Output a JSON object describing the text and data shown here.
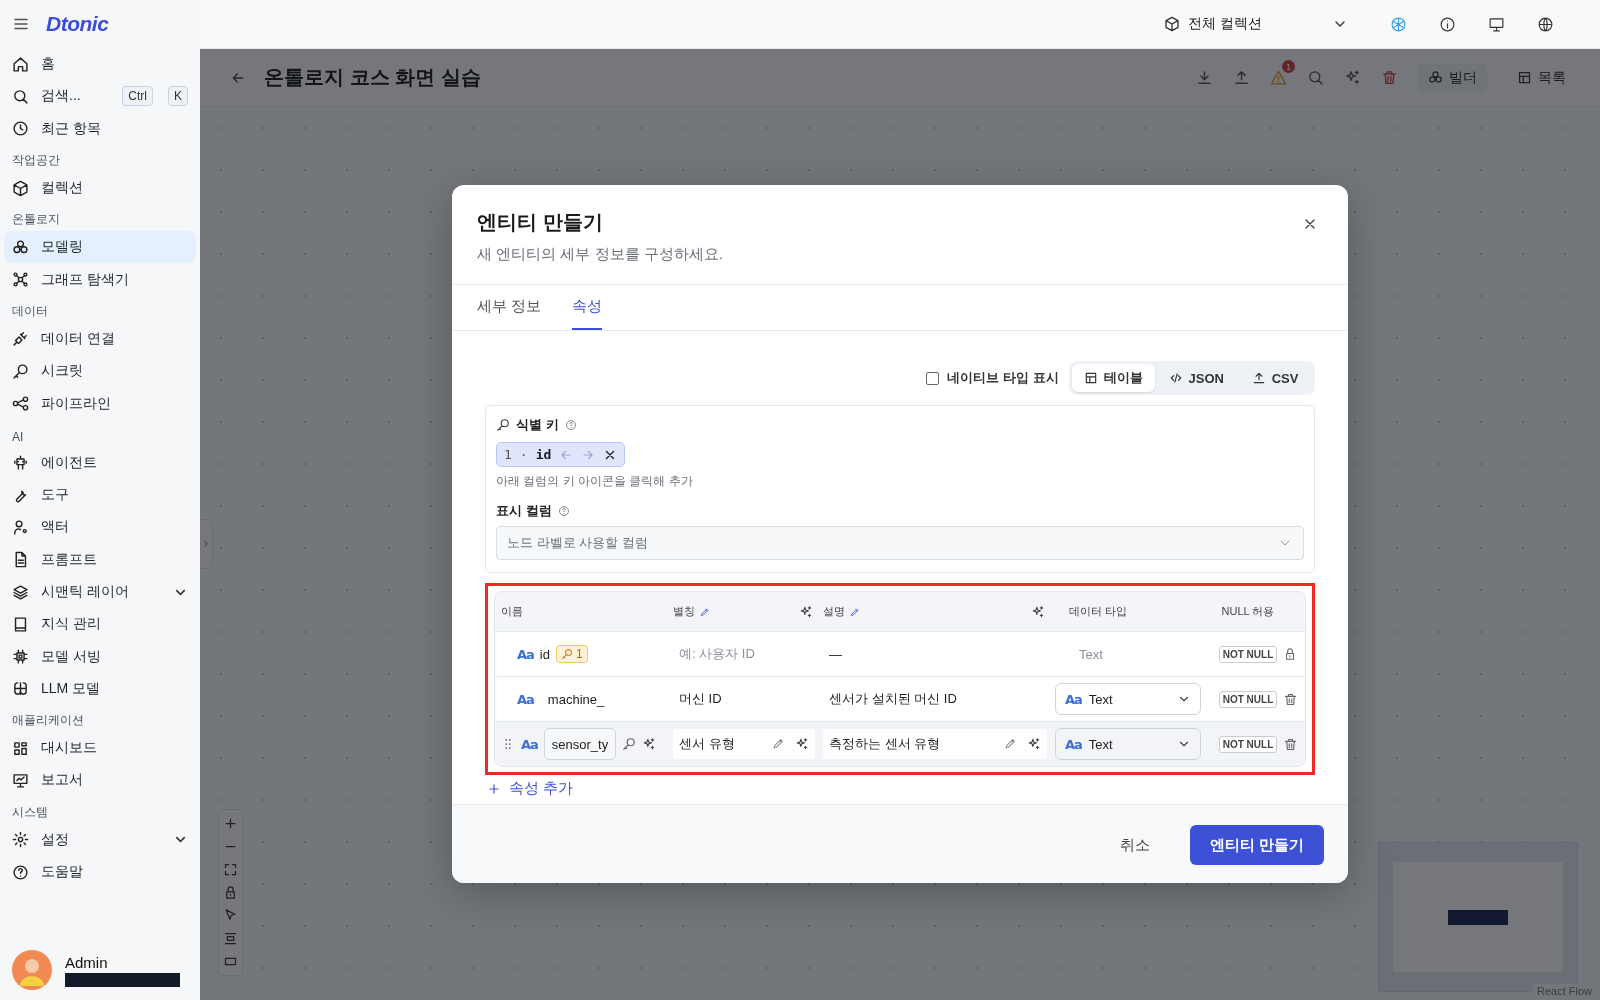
{
  "sidebar": {
    "logo": "Dtonic",
    "shortcut": [
      "Ctrl",
      "K"
    ],
    "items": [
      {
        "label": "홈",
        "selected": false
      },
      {
        "label": "검색...",
        "selected": false
      },
      {
        "label": "최근 항목",
        "selected": false
      }
    ],
    "sections": [
      {
        "title": "작업공간",
        "items": [
          {
            "label": "컬렉션",
            "selected": false
          }
        ]
      },
      {
        "title": "온톨로지",
        "items": [
          {
            "label": "모델링",
            "selected": true
          },
          {
            "label": "그래프 탐색기",
            "selected": false
          }
        ]
      },
      {
        "title": "데이터",
        "items": [
          {
            "label": "데이터 연결",
            "selected": false
          },
          {
            "label": "시크릿",
            "selected": false
          },
          {
            "label": "파이프라인",
            "selected": false
          }
        ]
      },
      {
        "title": "AI",
        "items": [
          {
            "label": "에이전트",
            "selected": false
          },
          {
            "label": "도구",
            "selected": false
          },
          {
            "label": "액터",
            "selected": false
          },
          {
            "label": "프롬프트",
            "selected": false
          },
          {
            "label": "시맨틱 레이어",
            "selected": false,
            "kind": "group",
            "expanded": false
          },
          {
            "label": "지식 관리",
            "selected": false
          },
          {
            "label": "모델 서빙",
            "selected": false
          },
          {
            "label": "LLM 모델",
            "selected": false
          }
        ]
      },
      {
        "title": "애플리케이션",
        "items": [
          {
            "label": "대시보드",
            "selected": false
          },
          {
            "label": "보고서",
            "selected": false
          }
        ]
      },
      {
        "title": "시스템",
        "items": [
          {
            "label": "설정",
            "selected": false,
            "kind": "group",
            "expanded": false
          },
          {
            "label": "도움말",
            "selected": false
          }
        ]
      }
    ],
    "user": {
      "name": "Admin"
    }
  },
  "topbar": {
    "collection": "전체 컬렉션"
  },
  "page": {
    "title": "온톨로지 코스 화면 실습",
    "warning_count": "1",
    "buttons": [
      "빌더",
      "목록"
    ],
    "attribution": "React Flow"
  },
  "modal": {
    "title": "엔티티 만들기",
    "subtitle": "새 엔티티의 세부 정보를 구성하세요.",
    "tabs": [
      {
        "label": "세부 정보",
        "selected": false
      },
      {
        "label": "속성",
        "selected": true
      }
    ],
    "native_types": {
      "label": "네이티브 타입 표시",
      "checked": false
    },
    "view_modes": [
      {
        "label": "테이블",
        "selected": true
      },
      {
        "label": "JSON",
        "selected": false
      },
      {
        "label": "CSV",
        "selected": false
      }
    ],
    "identifier_key": {
      "label": "식별 키",
      "chip_index": "1",
      "chip_separator": "·",
      "chip_name": "id",
      "hint": "아래 컬럼의 키 아이콘을 클릭해 추가"
    },
    "display_column": {
      "label": "표시 컬럼",
      "placeholder": "노드 라벨로 사용할 컬럼"
    },
    "table": {
      "columns": [
        "이름",
        "별칭",
        "설명",
        "데이터 타입",
        "NULL 허용"
      ],
      "rows": [
        {
          "kind": "key",
          "type_glyph": "Aa",
          "name": "id",
          "key_badge": "1",
          "alias": "예: 사용자 ID",
          "description": "—",
          "data_type": "Text",
          "nullability": "NOT NULL"
        },
        {
          "kind": "static",
          "type_glyph": "Aa",
          "name": "machine_",
          "alias": "머신 ID",
          "description": "센서가 설치된 머신 ID",
          "data_type_glyph": "Aa",
          "data_type": "Text",
          "nullability": "NOT NULL"
        },
        {
          "kind": "editing",
          "type_glyph": "Aa",
          "name": "sensor_ty",
          "alias": "센서 유형",
          "description": "측정하는 센서 유형",
          "data_type_glyph": "Aa",
          "data_type": "Text",
          "nullability": "NOT NULL"
        }
      ]
    },
    "add_label": "속성 추가",
    "cancel": "취소",
    "submit": "엔티티 만들기"
  }
}
